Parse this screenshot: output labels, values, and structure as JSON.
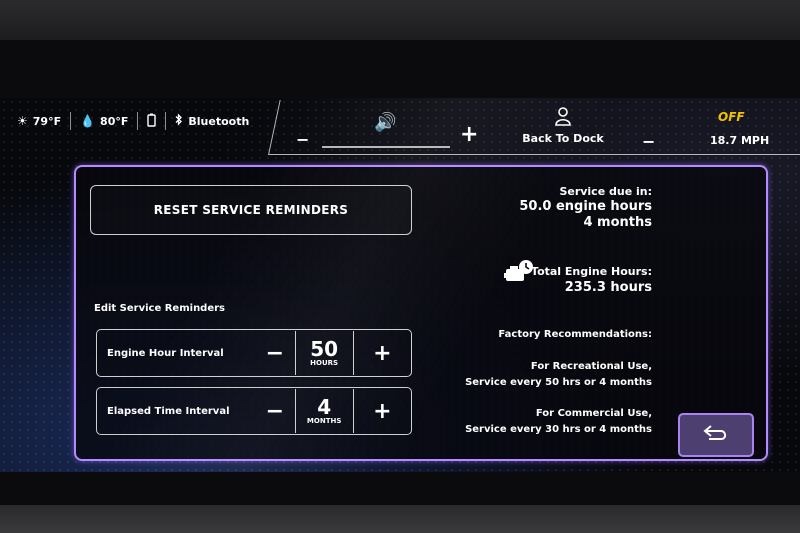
{
  "status_bar": {
    "outside_temp": "79°F",
    "water_temp": "80°F",
    "bluetooth_label": "Bluetooth"
  },
  "volume": {
    "minus": "−",
    "plus": "+"
  },
  "dock": {
    "label": "Back To Dock"
  },
  "speed": {
    "cruise_badge": "OFF",
    "value": "18.7 MPH"
  },
  "service": {
    "reset_button": "RESET SERVICE REMINDERS",
    "edit_title": "Edit Service Reminders",
    "engine_hour_interval": {
      "label": "Engine Hour Interval",
      "value": "50",
      "unit": "HOURS",
      "minus": "−",
      "plus": "+"
    },
    "elapsed_time_interval": {
      "label": "Elapsed Time Interval",
      "value": "4",
      "unit": "MONTHS",
      "minus": "−",
      "plus": "+"
    },
    "due_label": "Service due in:",
    "due_hours": "50.0 engine hours",
    "due_months": "4 months",
    "total_hours_label": "Total Engine Hours:",
    "total_hours_value": "235.3 hours",
    "factory_title": "Factory Recommendations:",
    "recreational_title": "For Recreational Use,",
    "recreational_detail": "Service every 50 hrs or 4 months",
    "commercial_title": "For Commercial Use,",
    "commercial_detail": "Service every 30 hrs or 4 months"
  },
  "colors": {
    "accent": "#b58cff",
    "badge": "#f2c200",
    "back_button": "#4d4070"
  },
  "icons": [
    "sun-icon",
    "water-drop-icon",
    "battery-icon",
    "bluetooth-icon",
    "speaker-icon",
    "person-icon",
    "engine-clock-icon",
    "return-arrow-icon"
  ]
}
